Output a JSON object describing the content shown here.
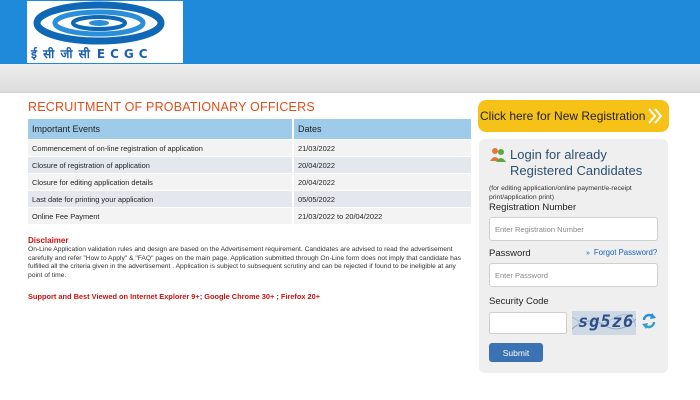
{
  "header": {
    "logo_text_hindi": "ई सी जी सी",
    "logo_text_latin": "ECGC"
  },
  "page_title": "RECRUITMENT OF PROBATIONARY OFFICERS",
  "events_table": {
    "headers": [
      "Important Events",
      "Dates"
    ],
    "rows": [
      [
        "Commencement of on-line registration of application",
        "21/03/2022"
      ],
      [
        "Closure of registration of application",
        "20/04/2022"
      ],
      [
        "Closure for editing application details",
        "20/04/2022"
      ],
      [
        "Last date for printing your application",
        "05/05/2022"
      ],
      [
        "Online Fee Payment",
        "21/03/2022 to 20/04/2022"
      ]
    ]
  },
  "disclaimer": {
    "title": "Disclaimer",
    "text": "On-Line Application validation rules and design are based on the Advertisement requirement. Candidates are advised to read the advertisement carefully and refer \"How to Apply\" & \"FAQ\" pages on the main page. Application submitted through On-Line form does not imply that candidate has fulfilled all the criteria given in the advertisement . Application is subject to subsequent scrutiny and can be rejected if found to be ineligible at any point of time.",
    "browser_note": "Support and Best Viewed on Internet Explorer 9+; Google Chrome 30+ ; Firefox 20+"
  },
  "new_registration": {
    "label": "Click here for New Registration"
  },
  "login": {
    "title": "Login for already Registered Candidates",
    "note": "(for editing application/online payment/e-receipt print/application print)",
    "registration_label": "Registration Number",
    "registration_placeholder": "Enter Registration Number",
    "password_label": "Password",
    "password_placeholder": "Enter Password",
    "forgot_label": "Forgot Password?",
    "security_label": "Security Code",
    "captcha_code": "sg5z6",
    "submit_label": "Submit"
  },
  "colors": {
    "header_blue": "#1f8ad9",
    "title_orange": "#e04e18",
    "table_header": "#9fcbea",
    "new_reg_yellow": "#f7c218",
    "submit_blue": "#3b72b4",
    "disclaimer_red": "#cc1111"
  },
  "icons": [
    "ecgc-logo",
    "double-chevron-right-icon",
    "users-icon",
    "refresh-icon"
  ]
}
